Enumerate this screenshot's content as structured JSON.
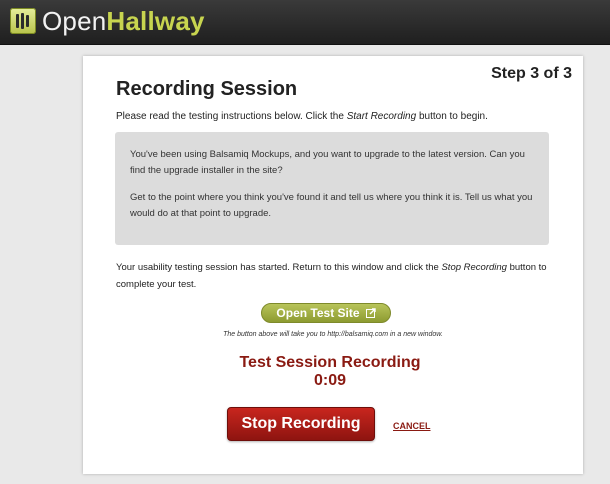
{
  "header": {
    "logo_part1": "Open",
    "logo_part2": "Hallway",
    "logo_icon": "openhallway-logo-icon"
  },
  "session": {
    "step": "Step 3 of 3",
    "title": "Recording Session",
    "intro_before": "Please read the testing instructions below. Click the ",
    "intro_em": "Start Recording",
    "intro_after": " button to begin.",
    "instructions": [
      "You've been using Balsamiq Mockups, and you want to upgrade to the latest version. Can you find the upgrade installer in the site?",
      "Get to the point where you think you've found it and tell us where you think it is. Tell us what you would do at that point to upgrade."
    ],
    "status_before": "Your usability testing session has started. Return to this window and click the ",
    "status_em": "Stop Recording",
    "status_after": " button to complete your test.",
    "open_site_label": "Open Test Site",
    "open_site_icon": "external-link-icon",
    "open_site_note": "The button above will take you to http://balsamiq.com in a new window.",
    "recording_title": "Test Session Recording",
    "timer": "0:09",
    "stop_label": "Stop Recording",
    "cancel_label": "CANCEL"
  },
  "colors": {
    "brand_green": "#c7d44f",
    "recording_red": "#8a1a12",
    "stop_button": "#b01f18"
  }
}
